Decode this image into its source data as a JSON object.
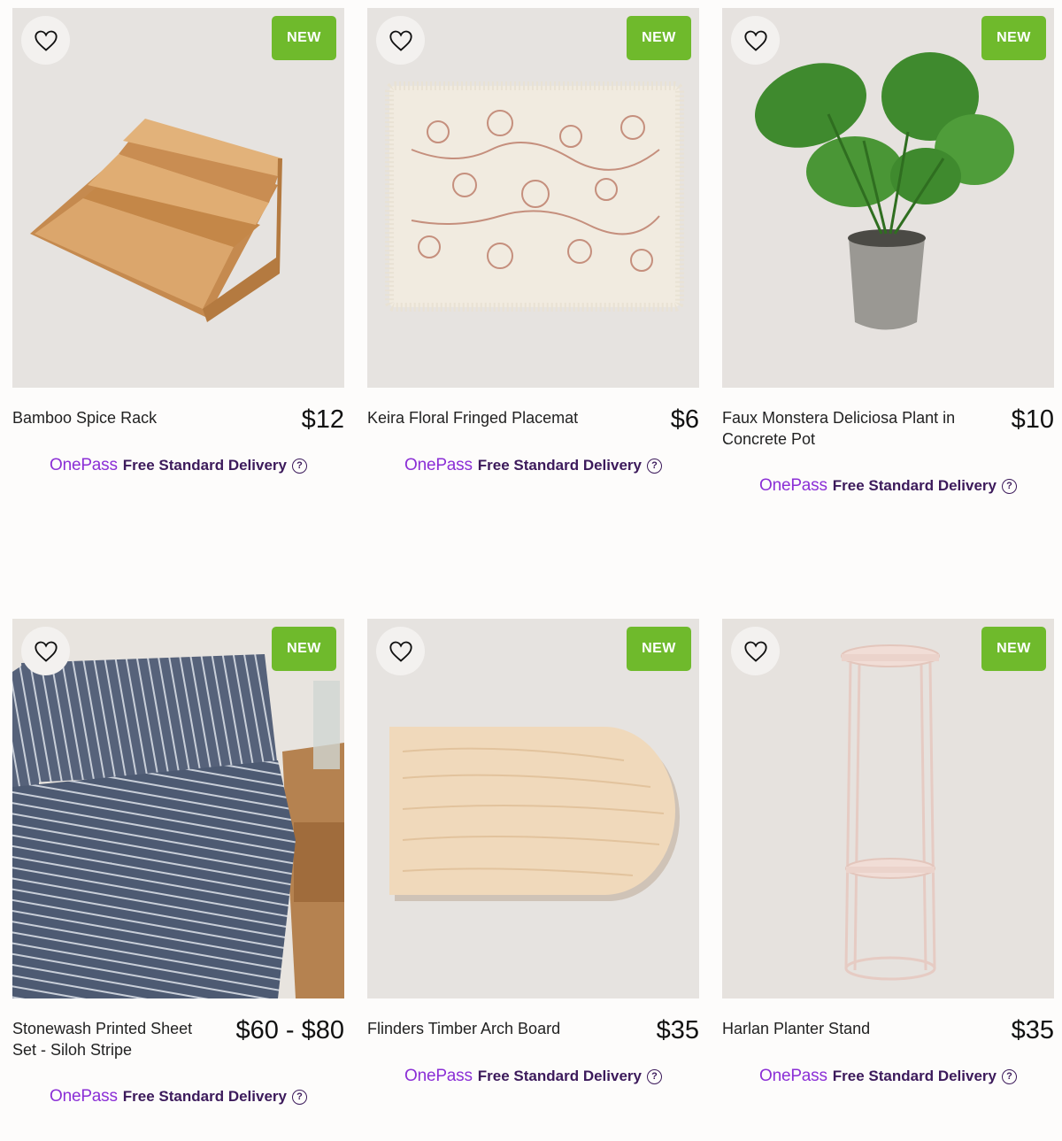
{
  "products": [
    {
      "name": "Bamboo Spice Rack",
      "price": "$12",
      "badge": "NEW",
      "image": "bamboo-spice-rack-image"
    },
    {
      "name": "Keira Floral Fringed Placemat",
      "price": "$6",
      "badge": "NEW",
      "image": "floral-placemat-image"
    },
    {
      "name": "Faux Monstera Deliciosa Plant in Concrete Pot",
      "price": "$10",
      "badge": "NEW",
      "image": "monstera-plant-image"
    },
    {
      "name": "Stonewash Printed Sheet Set - Siloh Stripe",
      "price": "$60 - $80",
      "badge": "NEW",
      "image": "striped-sheet-set-image"
    },
    {
      "name": "Flinders Timber Arch Board",
      "price": "$35",
      "badge": "NEW",
      "image": "timber-arch-board-image"
    },
    {
      "name": "Harlan Planter Stand",
      "price": "$35",
      "badge": "NEW",
      "image": "planter-stand-image"
    }
  ],
  "delivery": {
    "brand": "OnePass",
    "text": "Free Standard Delivery",
    "help_icon": "question-circle-icon"
  },
  "favourite_icon": "heart-outline-icon",
  "colors": {
    "badge": "#6fba2c",
    "onepass": "#8b2fd6",
    "delivery_text": "#3c1a5b"
  }
}
